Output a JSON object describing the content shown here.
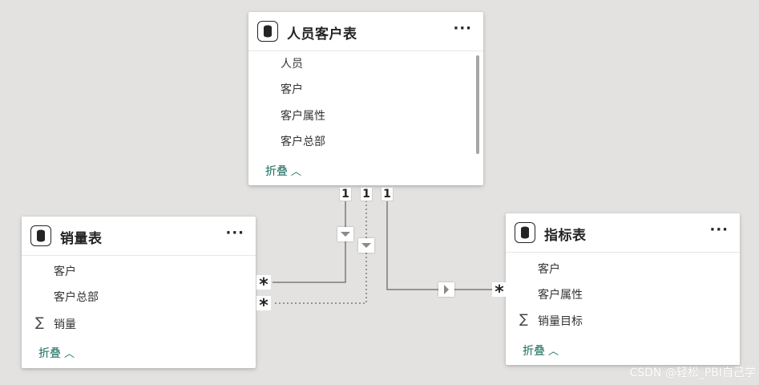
{
  "tables": {
    "person_customer": {
      "title": "人员客户表",
      "more": "···",
      "fields": [
        "人员",
        "客户",
        "客户属性",
        "客户总部"
      ],
      "collapse": "折叠",
      "collapse_icon": "^"
    },
    "sales": {
      "title": "销量表",
      "more": "···",
      "fields": [
        "客户",
        "客户总部",
        "销量"
      ],
      "sigma_field": "销量",
      "collapse": "折叠",
      "collapse_icon": "^"
    },
    "metrics": {
      "title": "指标表",
      "more": "···",
      "fields": [
        "客户",
        "客户属性",
        "销量目标"
      ],
      "sigma_field": "销量目标",
      "collapse": "折叠",
      "collapse_icon": "^"
    }
  },
  "relationships": {
    "one_label": "1",
    "many_label": "*",
    "sigma_symbol": "∑"
  },
  "watermark": "CSDN @轻松_PBI自己学",
  "colors": {
    "canvas": "#e3e2e1",
    "collapse_link": "#1a6b5e",
    "line": "#7a7a7a"
  }
}
